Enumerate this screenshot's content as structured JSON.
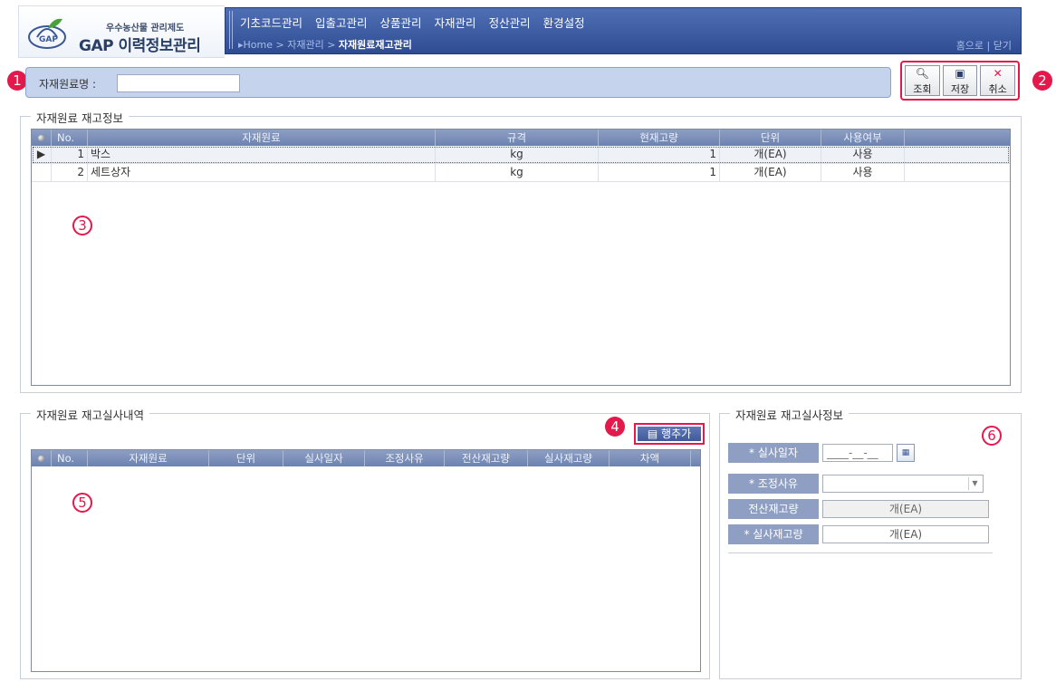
{
  "header": {
    "logo_sub": "우수농산물 관리제도",
    "logo_main": "GAP 이력정보관리",
    "menu": [
      "기초코드관리",
      "입출고관리",
      "상품관리",
      "자재관리",
      "정산관리",
      "환경설정"
    ],
    "breadcrumb_prefix": "▸Home > 자재관리 > ",
    "breadcrumb_current": "자재원료재고관리",
    "top_links": "홈으로 | 닫기"
  },
  "markers": [
    "1",
    "2",
    "3",
    "4",
    "5",
    "6"
  ],
  "search": {
    "label": "자재원료명 :",
    "value": ""
  },
  "toolbar": {
    "search": "조회",
    "save": "저장",
    "cancel": "취소"
  },
  "inventory": {
    "title": "자재원료 재고정보",
    "columns": [
      "No.",
      "자재원료",
      "규격",
      "현재고량",
      "단위",
      "사용여부"
    ],
    "rows": [
      {
        "no": "1",
        "name": "박스",
        "spec": "kg",
        "qty": "1",
        "unit": "개(EA)",
        "use": "사용"
      },
      {
        "no": "2",
        "name": "세트상자",
        "spec": "kg",
        "qty": "1",
        "unit": "개(EA)",
        "use": "사용"
      }
    ]
  },
  "audit": {
    "title": "자재원료 재고실사내역",
    "add_row": "행추가",
    "columns": [
      "No.",
      "자재원료",
      "단위",
      "실사일자",
      "조정사유",
      "전산재고량",
      "실사재고량",
      "차액"
    ]
  },
  "detail": {
    "title": "자재원료 재고실사정보",
    "date_label": "* 실사일자",
    "date_value": "____-__-__",
    "reason_label": "* 조정사유",
    "reason_value": "",
    "system_qty_label": "전산재고량",
    "system_qty_value": "개(EA)",
    "actual_qty_label": "* 실사재고량",
    "actual_qty_value": "개(EA)"
  },
  "colors": {
    "accent": "#e5184b",
    "nav": "#3a5796",
    "grid_header": "#7f93bd"
  }
}
